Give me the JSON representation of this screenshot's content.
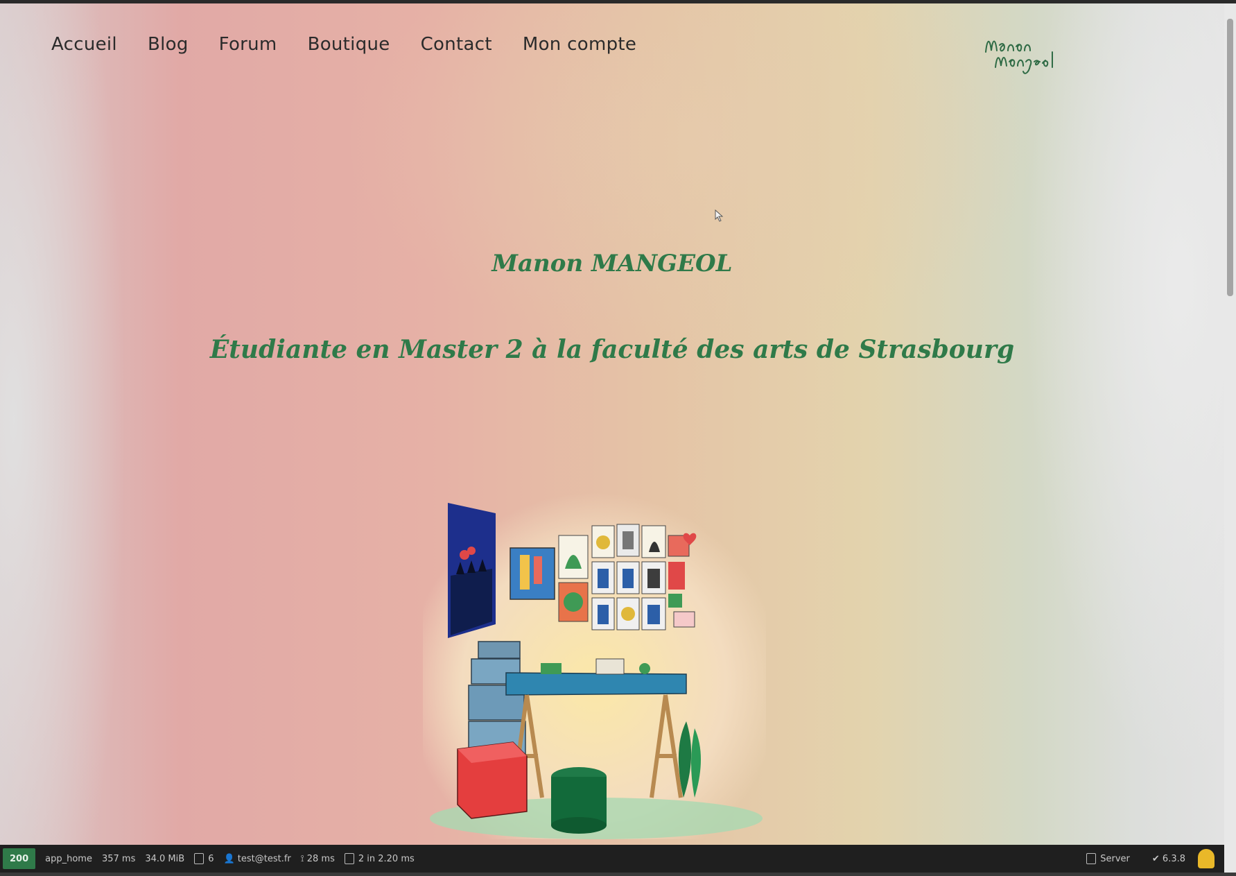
{
  "nav": {
    "items": [
      {
        "label": "Accueil"
      },
      {
        "label": "Blog"
      },
      {
        "label": "Forum"
      },
      {
        "label": "Boutique"
      },
      {
        "label": "Contact"
      },
      {
        "label": "Mon compte"
      }
    ]
  },
  "logo": {
    "text": "Manon Mangeol"
  },
  "hero": {
    "name": "Manon MANGEOL",
    "subtitle": "Étudiante en Master 2 à la faculté des arts de Strasbourg"
  },
  "statusbar": {
    "code": "200",
    "route": "app_home",
    "time": "357 ms",
    "memory": "34.0 MiB",
    "files": "6",
    "user": "test@test.fr",
    "count": "28 ms",
    "db": "2 in 2.20 ms",
    "server": "Server",
    "version": "6.3.8"
  },
  "colors": {
    "accent": "#2f7a49",
    "nav_text": "#2b2b2b",
    "status_ok": "#2f7a49"
  }
}
